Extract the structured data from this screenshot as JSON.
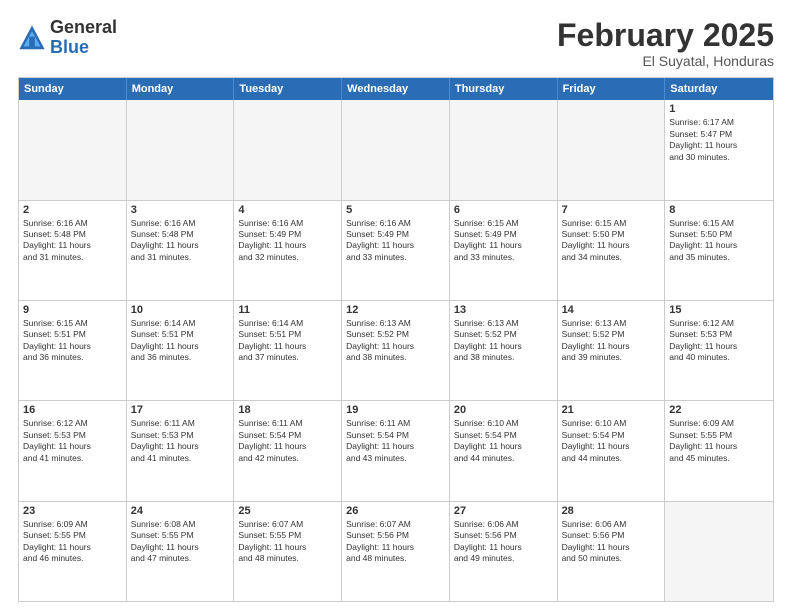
{
  "logo": {
    "general": "General",
    "blue": "Blue"
  },
  "title": "February 2025",
  "location": "El Suyatal, Honduras",
  "weekdays": [
    "Sunday",
    "Monday",
    "Tuesday",
    "Wednesday",
    "Thursday",
    "Friday",
    "Saturday"
  ],
  "weeks": [
    [
      {
        "day": "",
        "empty": true
      },
      {
        "day": "",
        "empty": true
      },
      {
        "day": "",
        "empty": true
      },
      {
        "day": "",
        "empty": true
      },
      {
        "day": "",
        "empty": true
      },
      {
        "day": "",
        "empty": true
      },
      {
        "day": "1",
        "lines": [
          "Sunrise: 6:17 AM",
          "Sunset: 5:47 PM",
          "Daylight: 11 hours",
          "and 30 minutes."
        ]
      }
    ],
    [
      {
        "day": "2",
        "lines": [
          "Sunrise: 6:16 AM",
          "Sunset: 5:48 PM",
          "Daylight: 11 hours",
          "and 31 minutes."
        ]
      },
      {
        "day": "3",
        "lines": [
          "Sunrise: 6:16 AM",
          "Sunset: 5:48 PM",
          "Daylight: 11 hours",
          "and 31 minutes."
        ]
      },
      {
        "day": "4",
        "lines": [
          "Sunrise: 6:16 AM",
          "Sunset: 5:49 PM",
          "Daylight: 11 hours",
          "and 32 minutes."
        ]
      },
      {
        "day": "5",
        "lines": [
          "Sunrise: 6:16 AM",
          "Sunset: 5:49 PM",
          "Daylight: 11 hours",
          "and 33 minutes."
        ]
      },
      {
        "day": "6",
        "lines": [
          "Sunrise: 6:15 AM",
          "Sunset: 5:49 PM",
          "Daylight: 11 hours",
          "and 33 minutes."
        ]
      },
      {
        "day": "7",
        "lines": [
          "Sunrise: 6:15 AM",
          "Sunset: 5:50 PM",
          "Daylight: 11 hours",
          "and 34 minutes."
        ]
      },
      {
        "day": "8",
        "lines": [
          "Sunrise: 6:15 AM",
          "Sunset: 5:50 PM",
          "Daylight: 11 hours",
          "and 35 minutes."
        ]
      }
    ],
    [
      {
        "day": "9",
        "lines": [
          "Sunrise: 6:15 AM",
          "Sunset: 5:51 PM",
          "Daylight: 11 hours",
          "and 36 minutes."
        ]
      },
      {
        "day": "10",
        "lines": [
          "Sunrise: 6:14 AM",
          "Sunset: 5:51 PM",
          "Daylight: 11 hours",
          "and 36 minutes."
        ]
      },
      {
        "day": "11",
        "lines": [
          "Sunrise: 6:14 AM",
          "Sunset: 5:51 PM",
          "Daylight: 11 hours",
          "and 37 minutes."
        ]
      },
      {
        "day": "12",
        "lines": [
          "Sunrise: 6:13 AM",
          "Sunset: 5:52 PM",
          "Daylight: 11 hours",
          "and 38 minutes."
        ]
      },
      {
        "day": "13",
        "lines": [
          "Sunrise: 6:13 AM",
          "Sunset: 5:52 PM",
          "Daylight: 11 hours",
          "and 38 minutes."
        ]
      },
      {
        "day": "14",
        "lines": [
          "Sunrise: 6:13 AM",
          "Sunset: 5:52 PM",
          "Daylight: 11 hours",
          "and 39 minutes."
        ]
      },
      {
        "day": "15",
        "lines": [
          "Sunrise: 6:12 AM",
          "Sunset: 5:53 PM",
          "Daylight: 11 hours",
          "and 40 minutes."
        ]
      }
    ],
    [
      {
        "day": "16",
        "lines": [
          "Sunrise: 6:12 AM",
          "Sunset: 5:53 PM",
          "Daylight: 11 hours",
          "and 41 minutes."
        ]
      },
      {
        "day": "17",
        "lines": [
          "Sunrise: 6:11 AM",
          "Sunset: 5:53 PM",
          "Daylight: 11 hours",
          "and 41 minutes."
        ]
      },
      {
        "day": "18",
        "lines": [
          "Sunrise: 6:11 AM",
          "Sunset: 5:54 PM",
          "Daylight: 11 hours",
          "and 42 minutes."
        ]
      },
      {
        "day": "19",
        "lines": [
          "Sunrise: 6:11 AM",
          "Sunset: 5:54 PM",
          "Daylight: 11 hours",
          "and 43 minutes."
        ]
      },
      {
        "day": "20",
        "lines": [
          "Sunrise: 6:10 AM",
          "Sunset: 5:54 PM",
          "Daylight: 11 hours",
          "and 44 minutes."
        ]
      },
      {
        "day": "21",
        "lines": [
          "Sunrise: 6:10 AM",
          "Sunset: 5:54 PM",
          "Daylight: 11 hours",
          "and 44 minutes."
        ]
      },
      {
        "day": "22",
        "lines": [
          "Sunrise: 6:09 AM",
          "Sunset: 5:55 PM",
          "Daylight: 11 hours",
          "and 45 minutes."
        ]
      }
    ],
    [
      {
        "day": "23",
        "lines": [
          "Sunrise: 6:09 AM",
          "Sunset: 5:55 PM",
          "Daylight: 11 hours",
          "and 46 minutes."
        ]
      },
      {
        "day": "24",
        "lines": [
          "Sunrise: 6:08 AM",
          "Sunset: 5:55 PM",
          "Daylight: 11 hours",
          "and 47 minutes."
        ]
      },
      {
        "day": "25",
        "lines": [
          "Sunrise: 6:07 AM",
          "Sunset: 5:55 PM",
          "Daylight: 11 hours",
          "and 48 minutes."
        ]
      },
      {
        "day": "26",
        "lines": [
          "Sunrise: 6:07 AM",
          "Sunset: 5:56 PM",
          "Daylight: 11 hours",
          "and 48 minutes."
        ]
      },
      {
        "day": "27",
        "lines": [
          "Sunrise: 6:06 AM",
          "Sunset: 5:56 PM",
          "Daylight: 11 hours",
          "and 49 minutes."
        ]
      },
      {
        "day": "28",
        "lines": [
          "Sunrise: 6:06 AM",
          "Sunset: 5:56 PM",
          "Daylight: 11 hours",
          "and 50 minutes."
        ]
      },
      {
        "day": "",
        "empty": true
      }
    ]
  ]
}
